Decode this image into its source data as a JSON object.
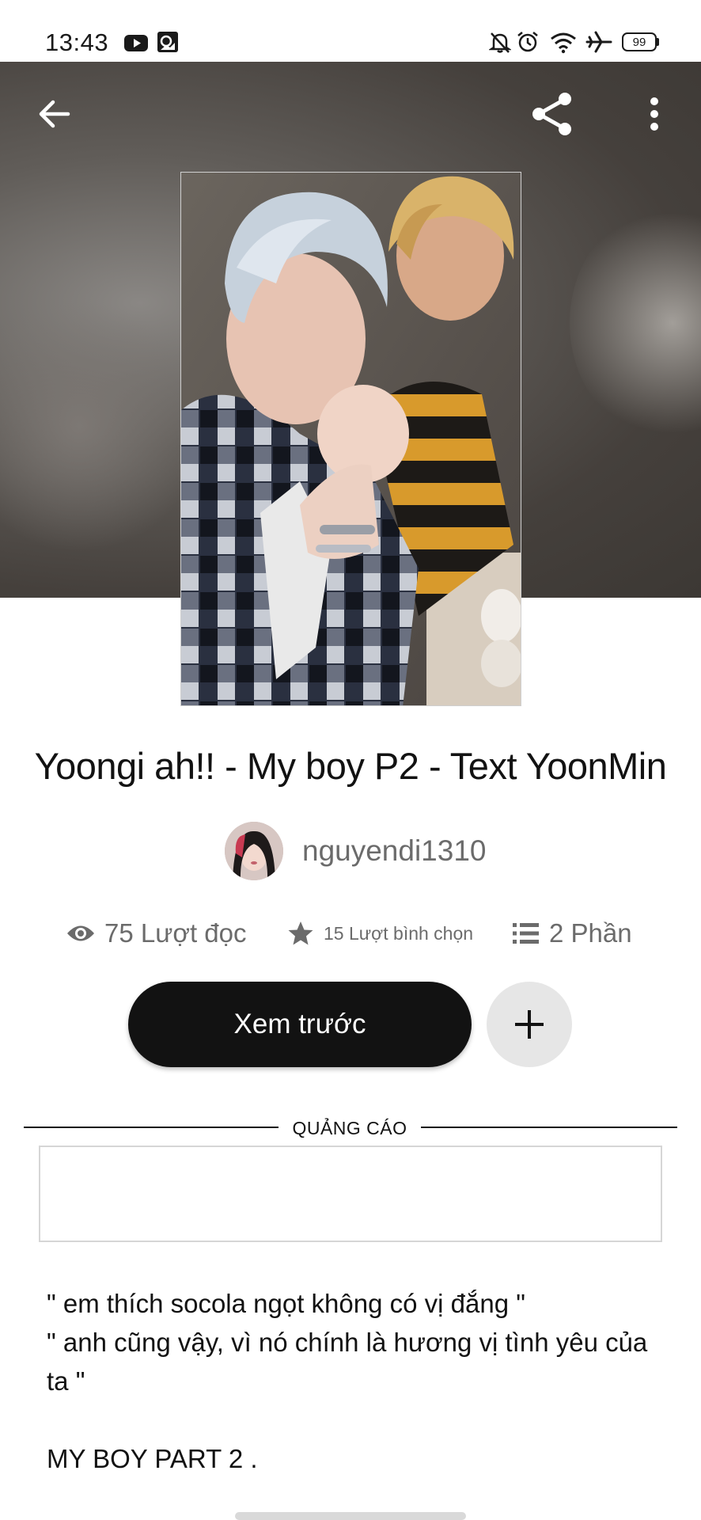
{
  "status_bar": {
    "time": "13:43",
    "battery": "99",
    "left_icons": [
      "youtube-icon",
      "gallery-icon"
    ],
    "right_icons": [
      "bell-off-icon",
      "alarm-icon",
      "wifi-icon",
      "airplane-icon",
      "battery-icon"
    ]
  },
  "toolbar": {
    "back_icon": "arrow-left-icon",
    "share_icon": "share-icon",
    "menu_icon": "more-vertical-icon"
  },
  "story": {
    "title": "Yoongi ah!!  - My boy P2 - Text YoonMin",
    "author": "nguyendi1310"
  },
  "stats": {
    "reads": "75 Lượt đọc",
    "votes": "15 Lượt bình chọn",
    "parts": "2 Phần"
  },
  "actions": {
    "preview_label": "Xem trước",
    "add_icon": "plus-icon"
  },
  "ad": {
    "label": "QUẢNG CÁO"
  },
  "description": {
    "line1": "\" em thích socola ngọt không có vị đắng \"",
    "line2": "\" anh cũng vậy, vì nó chính là hương vị tình yêu của ta \"",
    "line3": "MY BOY PART 2 ."
  },
  "colors": {
    "primary_button": "#121212",
    "secondary_button": "#e6e6e6",
    "muted_text": "#6b6b6b"
  }
}
